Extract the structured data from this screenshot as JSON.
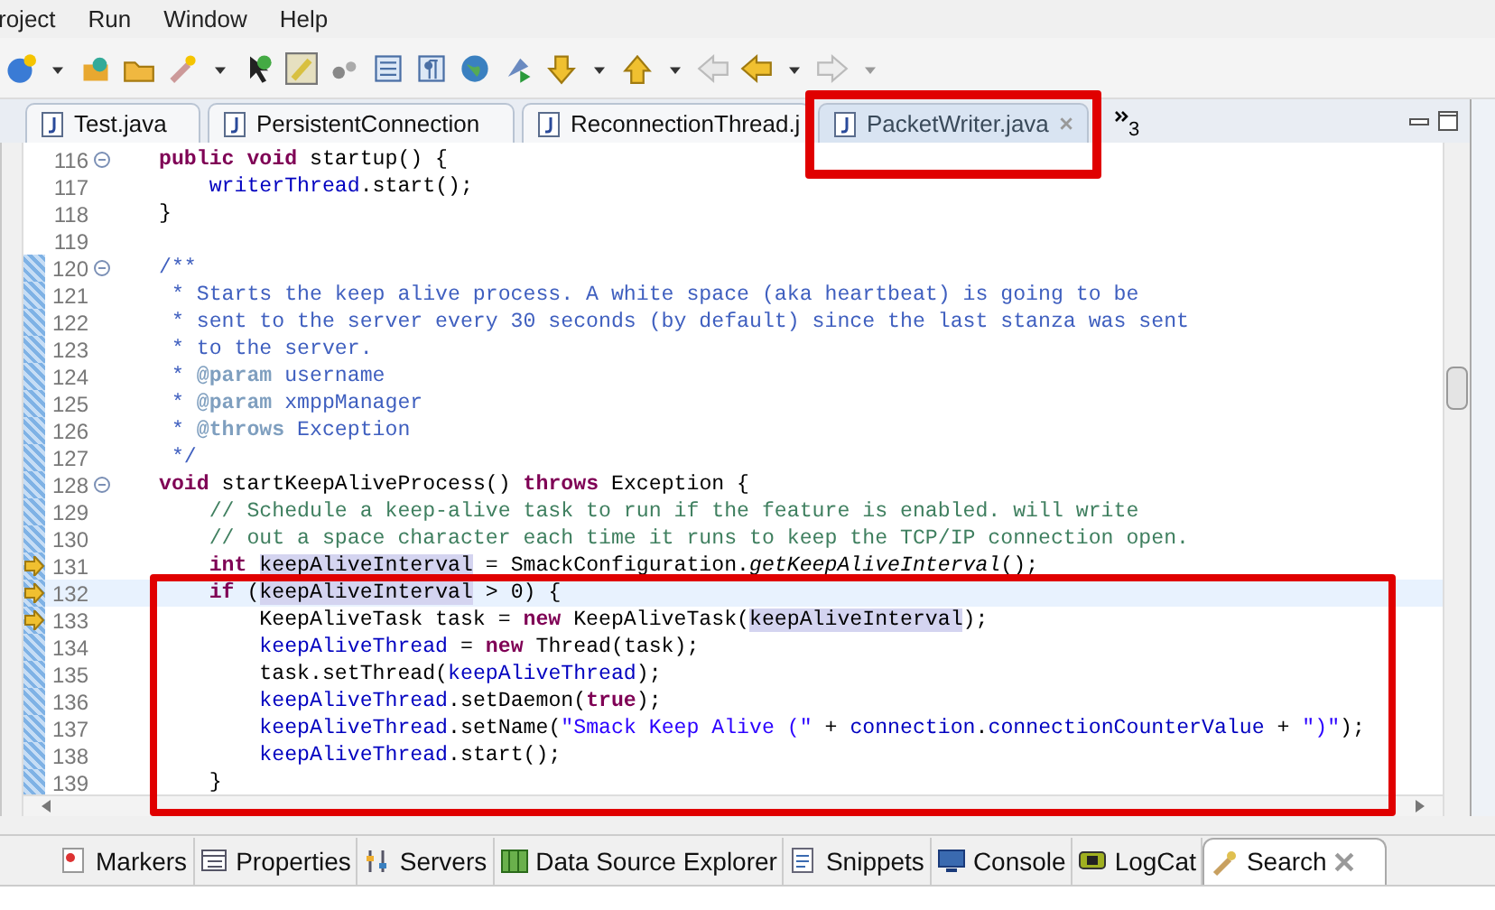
{
  "menu": [
    "roject",
    "Run",
    "Window",
    "Help"
  ],
  "editor_tabs": [
    {
      "label": "Test.java",
      "selected": false
    },
    {
      "label": "PersistentConnection",
      "selected": false
    },
    {
      "label": "ReconnectionThread.j",
      "selected": false
    },
    {
      "label": "PacketWriter.java",
      "selected": true
    }
  ],
  "hidden_tabs": "3",
  "lines": [
    {
      "number": "116",
      "fold": true,
      "changed": false,
      "arrow": false,
      "current": false,
      "tokens": [
        {
          "text": "public void",
          "kind": "keyword"
        },
        {
          "text": " startup() {",
          "kind": "plain"
        }
      ]
    },
    {
      "number": "117",
      "fold": false,
      "changed": false,
      "arrow": false,
      "current": false,
      "tokens": [
        {
          "text": "    writerThread",
          "kind": "field"
        },
        {
          "text": ".start();",
          "kind": "plain"
        }
      ]
    },
    {
      "number": "118",
      "fold": false,
      "changed": false,
      "arrow": false,
      "current": false,
      "tokens": [
        {
          "text": "}",
          "kind": "plain"
        }
      ]
    },
    {
      "number": "119",
      "fold": false,
      "changed": false,
      "arrow": false,
      "current": false
    },
    {
      "number": "120",
      "fold": true,
      "changed": true,
      "arrow": false,
      "current": false,
      "tokens": [
        {
          "text": "/**",
          "kind": "doc"
        }
      ]
    },
    {
      "number": "121",
      "fold": false,
      "changed": true,
      "arrow": false,
      "current": false,
      "tokens": [
        {
          "text": " * Starts the keep alive process. A white space (aka heartbeat) is going to be",
          "kind": "doc"
        }
      ]
    },
    {
      "number": "122",
      "fold": false,
      "changed": true,
      "arrow": false,
      "current": false,
      "tokens": [
        {
          "text": " * sent to the server every 30 seconds (by default) since the last stanza was sent",
          "kind": "doc"
        }
      ]
    },
    {
      "number": "123",
      "fold": false,
      "changed": true,
      "arrow": false,
      "current": false,
      "tokens": [
        {
          "text": " * to the server.",
          "kind": "doc"
        }
      ]
    },
    {
      "number": "124",
      "fold": false,
      "changed": true,
      "arrow": false,
      "current": false,
      "tokens": [
        {
          "text": " * ",
          "kind": "doc"
        },
        {
          "text": "@param",
          "kind": "doctag"
        },
        {
          "text": " username",
          "kind": "doc"
        }
      ]
    },
    {
      "number": "125",
      "fold": false,
      "changed": true,
      "arrow": false,
      "current": false,
      "tokens": [
        {
          "text": " * ",
          "kind": "doc"
        },
        {
          "text": "@param",
          "kind": "doctag"
        },
        {
          "text": " xmppManager",
          "kind": "doc"
        }
      ]
    },
    {
      "number": "126",
      "fold": false,
      "changed": true,
      "arrow": false,
      "current": false,
      "tokens": [
        {
          "text": " * ",
          "kind": "doc"
        },
        {
          "text": "@throws",
          "kind": "doctag"
        },
        {
          "text": " Exception",
          "kind": "doc"
        }
      ]
    },
    {
      "number": "127",
      "fold": false,
      "changed": true,
      "arrow": false,
      "current": false,
      "tokens": [
        {
          "text": " */",
          "kind": "doc"
        }
      ]
    },
    {
      "number": "128",
      "fold": true,
      "changed": true,
      "arrow": false,
      "current": false,
      "tokens": [
        {
          "text": "void",
          "kind": "keyword"
        },
        {
          "text": " startKeepAliveProcess() ",
          "kind": "plain"
        },
        {
          "text": "throws",
          "kind": "keyword"
        },
        {
          "text": " Exception {",
          "kind": "plain"
        }
      ]
    },
    {
      "number": "129",
      "fold": false,
      "changed": true,
      "arrow": false,
      "current": false,
      "tokens": [
        {
          "text": "    // Schedule a keep-alive task to run if the feature is enabled. will write",
          "kind": "comment"
        }
      ]
    },
    {
      "number": "130",
      "fold": false,
      "changed": true,
      "arrow": false,
      "current": false,
      "tokens": [
        {
          "text": "    // out a space character each time it runs to keep the TCP/IP connection open.",
          "kind": "comment"
        }
      ]
    },
    {
      "number": "131",
      "fold": false,
      "changed": true,
      "arrow": true,
      "current": false,
      "tokens": [
        {
          "text": "    int ",
          "kind": "keyword"
        },
        {
          "text": "keepAliveInterval",
          "kind": "occurrence"
        },
        {
          "text": " = SmackConfiguration.",
          "kind": "plain"
        },
        {
          "text": "getKeepAliveInterval",
          "kind": "static"
        },
        {
          "text": "();",
          "kind": "plain"
        }
      ]
    },
    {
      "number": "132",
      "fold": false,
      "changed": true,
      "arrow": true,
      "current": true,
      "tokens": [
        {
          "text": "    if",
          "kind": "keyword"
        },
        {
          "text": " (",
          "kind": "plain"
        },
        {
          "text": "keepAliveInterval",
          "kind": "occurrence"
        },
        {
          "text": " > 0) {",
          "kind": "plain"
        }
      ]
    },
    {
      "number": "133",
      "fold": false,
      "changed": true,
      "arrow": true,
      "current": false,
      "tokens": [
        {
          "text": "        KeepAliveTask task = ",
          "kind": "plain"
        },
        {
          "text": "new",
          "kind": "keyword"
        },
        {
          "text": " KeepAliveTask(",
          "kind": "plain"
        },
        {
          "text": "keepAliveInterval",
          "kind": "occurrence"
        },
        {
          "text": ");",
          "kind": "plain"
        }
      ]
    },
    {
      "number": "134",
      "fold": false,
      "changed": true,
      "arrow": false,
      "current": false,
      "tokens": [
        {
          "text": "        keepAliveThread",
          "kind": "field"
        },
        {
          "text": " = ",
          "kind": "plain"
        },
        {
          "text": "new",
          "kind": "keyword"
        },
        {
          "text": " Thread(task);",
          "kind": "plain"
        }
      ]
    },
    {
      "number": "135",
      "fold": false,
      "changed": true,
      "arrow": false,
      "current": false,
      "tokens": [
        {
          "text": "        task.setThread(",
          "kind": "plain"
        },
        {
          "text": "keepAliveThread",
          "kind": "field"
        },
        {
          "text": ");",
          "kind": "plain"
        }
      ]
    },
    {
      "number": "136",
      "fold": false,
      "changed": true,
      "arrow": false,
      "current": false,
      "tokens": [
        {
          "text": "        keepAliveThread",
          "kind": "field"
        },
        {
          "text": ".setDaemon(",
          "kind": "plain"
        },
        {
          "text": "true",
          "kind": "keyword"
        },
        {
          "text": ");",
          "kind": "plain"
        }
      ]
    },
    {
      "number": "137",
      "fold": false,
      "changed": true,
      "arrow": false,
      "current": false,
      "tokens": [
        {
          "text": "        keepAliveThread",
          "kind": "field"
        },
        {
          "text": ".setName(",
          "kind": "plain"
        },
        {
          "text": "\"Smack Keep Alive (\"",
          "kind": "string"
        },
        {
          "text": " + ",
          "kind": "plain"
        },
        {
          "text": "connection",
          "kind": "field"
        },
        {
          "text": ".",
          "kind": "plain"
        },
        {
          "text": "connectionCounterValue",
          "kind": "field"
        },
        {
          "text": " + ",
          "kind": "plain"
        },
        {
          "text": "\")\"",
          "kind": "string"
        },
        {
          "text": ");",
          "kind": "plain"
        }
      ]
    },
    {
      "number": "138",
      "fold": false,
      "changed": true,
      "arrow": false,
      "current": false,
      "tokens": [
        {
          "text": "        keepAliveThread",
          "kind": "field"
        },
        {
          "text": ".start();",
          "kind": "plain"
        }
      ]
    },
    {
      "number": "139",
      "fold": false,
      "changed": true,
      "arrow": false,
      "current": false,
      "tokens": [
        {
          "text": "    }",
          "kind": "plain"
        }
      ]
    }
  ],
  "bottom_tabs": [
    {
      "label": "Markers",
      "selected": false
    },
    {
      "label": "Properties",
      "selected": false
    },
    {
      "label": "Servers",
      "selected": false
    },
    {
      "label": "Data Source Explorer",
      "selected": false
    },
    {
      "label": "Snippets",
      "selected": false
    },
    {
      "label": "Console",
      "selected": false
    },
    {
      "label": "LogCat",
      "selected": false
    },
    {
      "label": "Search",
      "selected": true
    }
  ]
}
